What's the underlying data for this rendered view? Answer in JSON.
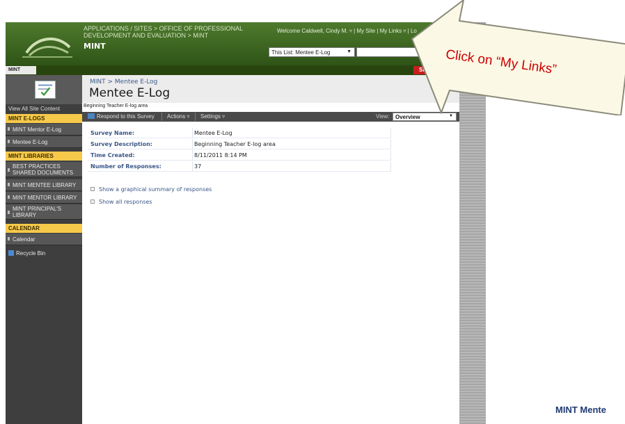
{
  "slide": {
    "footer_label": "MINT Mente"
  },
  "header": {
    "breadcrumb": "Applications / Sites > OFFICE OF PROFESSIONAL DEVELOPMENT AND EVALUATION > MINT",
    "site_name": "MINT",
    "welcome": "Welcome Caldwell, Cindy M. ▿ | My Site | My Links ▿ | Lo",
    "list_select_value": "This List: Mentee E-Log"
  },
  "topnav": {
    "tab": "MINT",
    "site_actions": "Site Ac"
  },
  "sidebar": {
    "view_all": "View All Site Content",
    "sections": [
      {
        "header": "MINT E-LOGS",
        "items": [
          "MINT Mentor E-Log",
          "Mentee E-Log"
        ]
      },
      {
        "header": "MINT LIBRARIES",
        "items": [
          "BEST PRACTICES SHARED DOCUMENTS",
          "MINT MENTEE LIBRARY",
          "MINT MENTOR LIBRARY",
          "MINT PRINCIPAL'S LIBRARY"
        ]
      },
      {
        "header": "CALENDAR",
        "items": [
          "Calendar"
        ]
      }
    ],
    "recycle_bin": "Recycle Bin"
  },
  "page": {
    "breadcrumb": "MINT > Mentee E-Log",
    "title": "Mentee E-Log",
    "description": "Beginning Teacher E-log area"
  },
  "toolbar": {
    "respond": "Respond to this Survey",
    "actions": "Actions ▿",
    "settings": "Settings ▿",
    "view_label": "View:",
    "view_value": "Overview"
  },
  "details": [
    {
      "label": "Survey Name:",
      "value": "Mentee E-Log"
    },
    {
      "label": "Survey Description:",
      "value": "Beginning Teacher E-log area"
    },
    {
      "label": "Time Created:",
      "value": "8/11/2011 8:14 PM"
    },
    {
      "label": "Number of Responses:",
      "value": "37"
    }
  ],
  "links": {
    "graphical_summary": "Show a graphical summary of responses",
    "all_responses": "Show all responses"
  },
  "callout": {
    "text": "Click on “My Links”",
    "text_color": "#cc0000",
    "fill_color": "#fbf8e6"
  }
}
